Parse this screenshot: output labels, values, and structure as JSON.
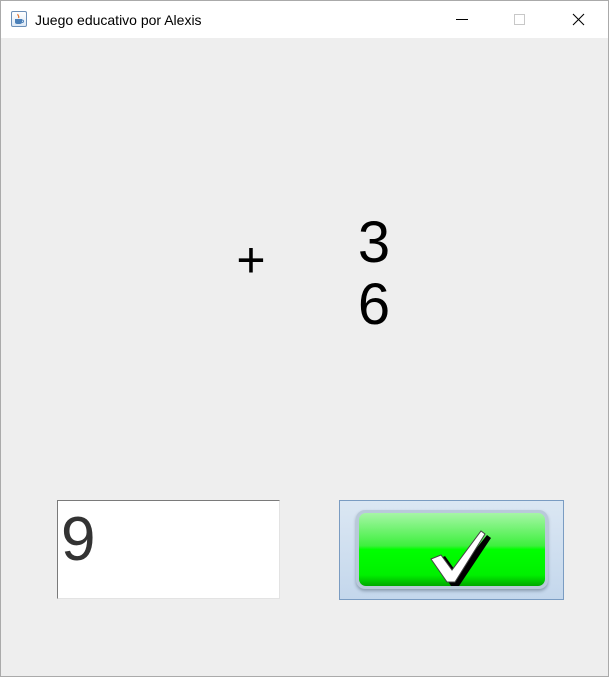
{
  "window": {
    "title": "Juego educativo por Alexis",
    "icon": "java-cup-icon",
    "controls": [
      "minimize-icon",
      "maximize-icon",
      "close-icon"
    ]
  },
  "problem": {
    "operator": "+",
    "operand_top": "3",
    "operand_bottom": "6"
  },
  "answer": {
    "value": "9"
  },
  "check_button": {
    "icon": "checkmark-icon",
    "colors": {
      "green": "#00ff00",
      "border": "#7a9cc2"
    }
  }
}
